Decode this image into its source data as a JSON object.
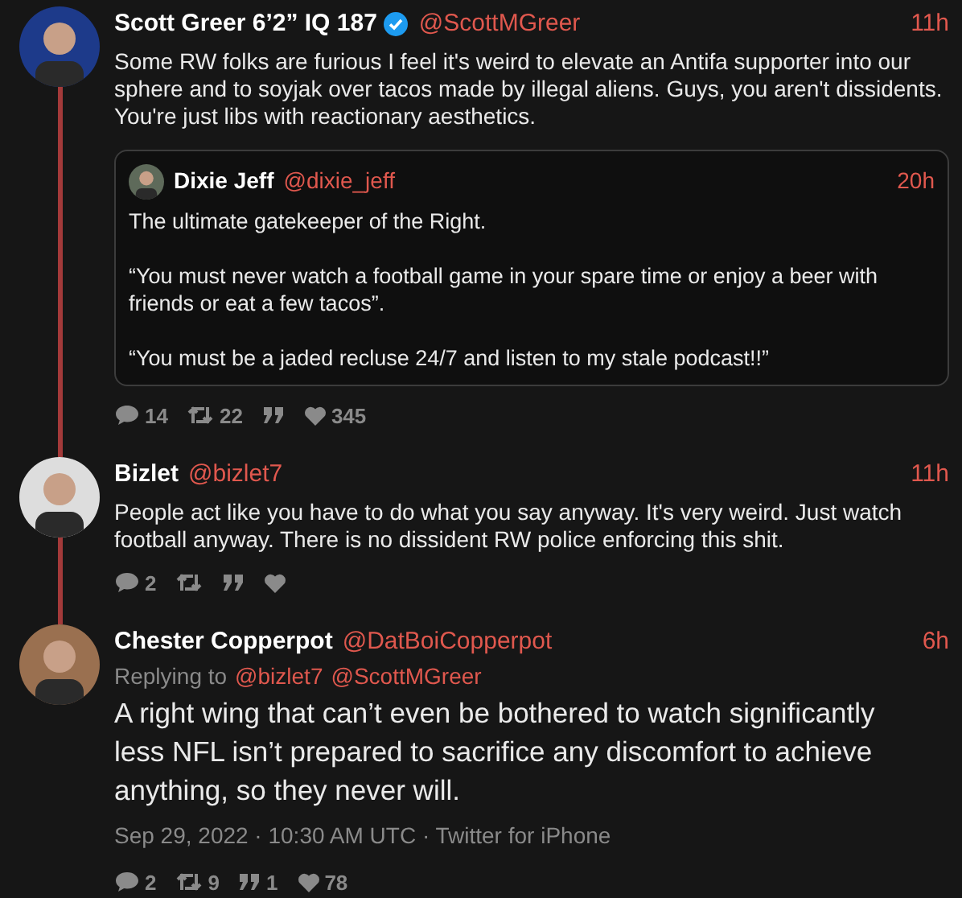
{
  "tweets": [
    {
      "kind": "reply",
      "name": "Scott Greer 6’2” IQ 187",
      "verified": true,
      "handle": "@ScottMGreer",
      "time": "11h",
      "connected": true,
      "text": "Some RW folks are furious I feel it's weird to elevate an Antifa supporter into our sphere and to soyjak over tacos made by illegal aliens. Guys, you aren't dissidents. You're just libs with reactionary aesthetics.",
      "quote": {
        "name": "Dixie Jeff",
        "handle": "@dixie_jeff",
        "time": "20h",
        "paragraphs": [
          "The ultimate gatekeeper of the Right.",
          "“You must never watch a football game in your spare time or enjoy a beer with friends or eat a few tacos”.",
          "“You must be a jaded recluse 24/7 and listen to my stale podcast!!”"
        ]
      },
      "stats": [
        {
          "kind": "comment",
          "count": "14"
        },
        {
          "kind": "retweet",
          "count": "22"
        },
        {
          "kind": "quote"
        },
        {
          "kind": "like",
          "count": "345"
        }
      ]
    },
    {
      "kind": "reply",
      "name": "Bizlet",
      "verified": false,
      "handle": "@bizlet7",
      "time": "11h",
      "connected": true,
      "text": "People act like you have to do what you say anyway. It's very weird. Just watch football anyway. There is no dissident RW police enforcing this shit.",
      "stats": [
        {
          "kind": "comment",
          "count": "2"
        },
        {
          "kind": "retweet"
        },
        {
          "kind": "quote"
        },
        {
          "kind": "like"
        }
      ]
    },
    {
      "kind": "focused",
      "name": "Chester Copperpot",
      "verified": false,
      "handle": "@DatBoiCopperpot",
      "time": "6h",
      "connected": false,
      "replying_label": "Replying to",
      "replying_to": [
        "@bizlet7",
        "@ScottMGreer"
      ],
      "text": "A right wing that can’t even be bothered to watch significantly less NFL isn’t prepared to sacrifice any discomfort to achieve anything, so they never will.",
      "date": "Sep 29, 2022 · 10:30 AM UTC · Twitter for iPhone",
      "stats": [
        {
          "kind": "comment",
          "count": "2"
        },
        {
          "kind": "retweet",
          "count": "9"
        },
        {
          "kind": "quote",
          "count": "1"
        },
        {
          "kind": "like",
          "count": "78"
        }
      ]
    }
  ]
}
